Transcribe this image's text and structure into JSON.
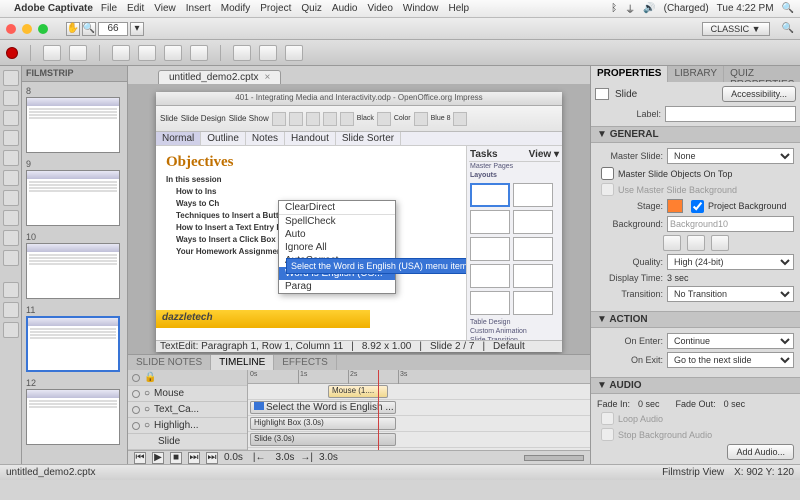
{
  "menubar": {
    "apple": "",
    "app": "Adobe Captivate",
    "items": [
      "File",
      "Edit",
      "View",
      "Insert",
      "Modify",
      "Project",
      "Quiz",
      "Audio",
      "Video",
      "Window",
      "Help"
    ],
    "battery": "(Charged)",
    "clock": "Tue 4:22 PM"
  },
  "control": {
    "zoom": "66",
    "workspace": "CLASSIC ▼"
  },
  "doc_tab": {
    "title": "untitled_demo2.cptx",
    "close": "×"
  },
  "filmstrip": {
    "title": "FILMSTRIP",
    "slides": [
      {
        "n": "8"
      },
      {
        "n": "9"
      },
      {
        "n": "10"
      },
      {
        "n": "11",
        "selected": true
      },
      {
        "n": "12"
      }
    ]
  },
  "ooo": {
    "title": "401 - Integrating Media and Interactivity.odp - OpenOffice.org Impress",
    "toolbar_tabs": [
      "Slide",
      "Slide Design",
      "Slide Show"
    ],
    "color_labels": [
      "Black",
      "Color",
      "Blue 8"
    ],
    "view_tabs": [
      "Normal",
      "Outline",
      "Notes",
      "Handout",
      "Slide Sorter"
    ],
    "slide_heading": "Objectives",
    "slide_sub": "In this session",
    "bullets": [
      "How to Ins",
      "Ways to Ch",
      "Techniques to Insert a Button Interaction and Set Options",
      "How to Insert a Text Entry Interaction and Set Options",
      "Ways to Insert a Click Box Interaction and Set Options",
      "Your Homework Assignment"
    ],
    "ctx": [
      "ClearDirect",
      "SpellCheck",
      "Auto",
      "Ignore All",
      "AutoCorrect",
      "Word is English (US...",
      "Parag"
    ],
    "tooltip": "Select the Word is English (USA) menu item",
    "footer": "dazzletech",
    "tasks_title": "Tasks",
    "tasks_view": "View ▾",
    "tasks_master": "Master Pages",
    "tasks_layouts": "Layouts",
    "tasks_sections": [
      "Table Design",
      "Custom Animation",
      "Slide Transition"
    ],
    "status": [
      "TextEdit: Paragraph 1, Row 1, Column 11",
      "8.92 x 1.00",
      "Slide 2 / 7",
      "Default"
    ]
  },
  "timeline": {
    "tabs": [
      "SLIDE NOTES",
      "TIMELINE",
      "EFFECTS"
    ],
    "tracks": [
      "Mouse",
      "Text_Ca...",
      "Highligh...",
      "Slide"
    ],
    "clips": {
      "mouse": "Mouse (1....",
      "text": "Select the Word is English ...",
      "highlight": "Highlight Box (3.0s)",
      "slide": "Slide (3.0s)"
    },
    "ruler": [
      "0s",
      "1s",
      "2s",
      "3s"
    ],
    "foot": {
      "time": "0.0s",
      "end": "3.0s",
      "total": "3.0s"
    }
  },
  "props": {
    "tabs": [
      "PROPERTIES",
      "LIBRARY",
      "QUIZ PROPERTIES"
    ],
    "obj": "Slide",
    "accessibility": "Accessibility...",
    "label_lbl": "Label:",
    "label_val": "",
    "general": {
      "title": "GENERAL",
      "master_lbl": "Master Slide:",
      "master_val": "None",
      "cb1": "Master Slide Objects On Top",
      "cb2": "Use Master Slide Background",
      "stage_lbl": "Stage:",
      "stage_cb": "Project Background",
      "bg_lbl": "Background:",
      "bg_val": "Background10",
      "quality_lbl": "Quality:",
      "quality_val": "High (24-bit)",
      "dtime_lbl": "Display Time:",
      "dtime_val": "3 sec",
      "trans_lbl": "Transition:",
      "trans_val": "No Transition"
    },
    "action": {
      "title": "ACTION",
      "enter_lbl": "On Enter:",
      "enter_val": "Continue",
      "exit_lbl": "On Exit:",
      "exit_val": "Go to the next slide"
    },
    "audio": {
      "title": "AUDIO",
      "fadein_lbl": "Fade In:",
      "fadein_val": "0 sec",
      "fadeout_lbl": "Fade Out:",
      "fadeout_val": "0 sec",
      "loop": "Loop Audio",
      "stopbg": "Stop Background Audio",
      "add": "Add Audio..."
    }
  },
  "status": {
    "file": "untitled_demo2.cptx",
    "view": "Filmstrip View",
    "coords": "X: 902 Y: 120"
  }
}
